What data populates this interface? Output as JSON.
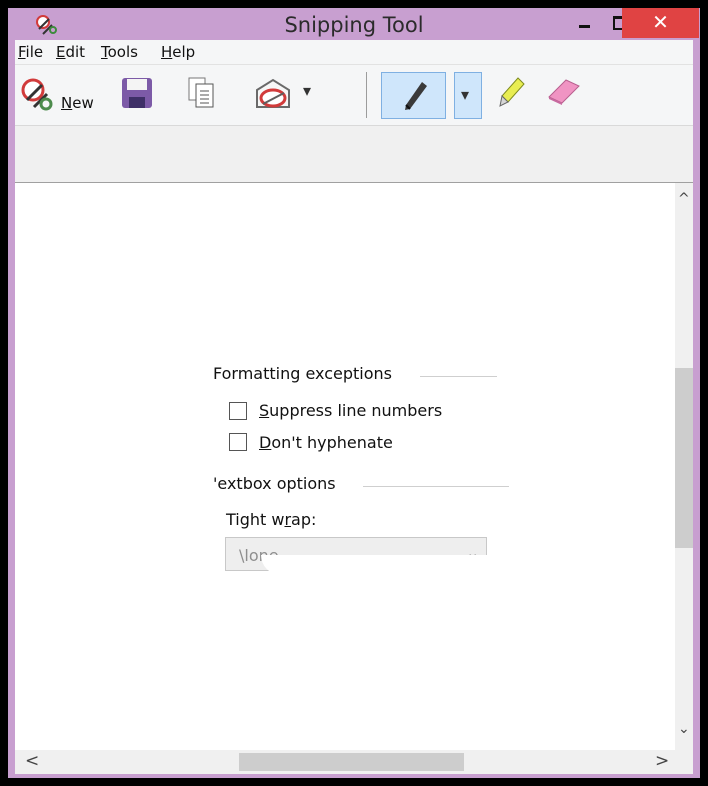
{
  "window": {
    "title": "Snipping Tool",
    "close_glyph": "✕",
    "accent_color": "#c89fd0",
    "close_color": "#e04343"
  },
  "menu": {
    "items": [
      {
        "label": "File",
        "mnemonic": "F",
        "rest": "ile"
      },
      {
        "label": "Edit",
        "mnemonic": "E",
        "rest": "dit"
      },
      {
        "label": "Tools",
        "mnemonic": "T",
        "rest": "ools"
      },
      {
        "label": "Help",
        "mnemonic": "H",
        "rest": "elp"
      }
    ]
  },
  "toolbar": {
    "new_label": "New",
    "new_mnemonic": "N",
    "new_rest": "ew",
    "icons": [
      "scissors-icon",
      "save-icon",
      "copy-icon",
      "send-snip-icon",
      "pen-icon",
      "highlighter-icon",
      "eraser-icon"
    ],
    "dropdown_glyph": "▾"
  },
  "snip": {
    "formatting_header": "Formatting exceptions",
    "suppress_label": "Suppress line numbers",
    "suppress_mnemonic": "S",
    "suppress_rest": "uppress line numbers",
    "hyphenate_label": "Don't hyphenate",
    "hyphenate_mnemonic": "D",
    "hyphenate_rest": "on't hyphenate",
    "textbox_header": "Textbox options",
    "textbox_header_visible": "'extbox options",
    "tight_wrap_label": "Tight wrap:",
    "tight_wrap_pre": "Tight w",
    "tight_wrap_mnemonic": "r",
    "tight_wrap_post": "ap:",
    "tight_wrap_value": "None",
    "tight_wrap_value_visible": "\\lone",
    "select_arrow": "⌄",
    "suppress_checked": false,
    "hyphenate_checked": false
  },
  "scroll": {
    "up": "^",
    "down": "⌄",
    "left": "<",
    "right": ">"
  }
}
